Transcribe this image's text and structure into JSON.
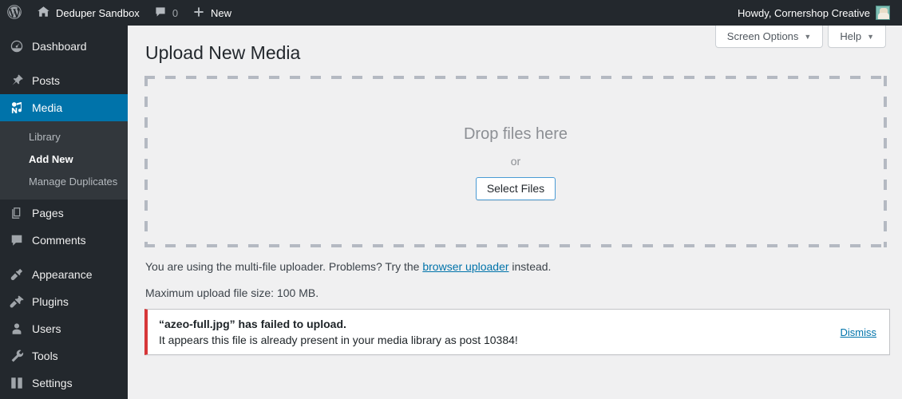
{
  "adminbar": {
    "logo_icon": "wordpress-logo-icon",
    "home_icon": "home-icon",
    "site_name": "Deduper Sandbox",
    "comments_icon": "comment-bubble-icon",
    "comments_count": "0",
    "new_icon": "plus-icon",
    "new_label": "New",
    "howdy": "Howdy, Cornershop Creative",
    "avatar": "user-avatar"
  },
  "sidebar": {
    "items": [
      {
        "label": "Dashboard",
        "icon": "dashboard-icon",
        "current": false,
        "gap_after": true
      },
      {
        "label": "Posts",
        "icon": "pin-icon",
        "current": false,
        "gap_after": false
      },
      {
        "label": "Media",
        "icon": "media-icon",
        "current": true,
        "gap_after": false
      }
    ],
    "submenu": [
      {
        "label": "Library",
        "current": false
      },
      {
        "label": "Add New",
        "current": true
      },
      {
        "label": "Manage Duplicates",
        "current": false
      }
    ],
    "items_lower": [
      {
        "label": "Pages",
        "icon": "pages-icon"
      },
      {
        "label": "Comments",
        "icon": "comment-icon"
      }
    ],
    "items_bottom": [
      {
        "label": "Appearance",
        "icon": "appearance-brush-icon"
      },
      {
        "label": "Plugins",
        "icon": "plugin-icon"
      },
      {
        "label": "Users",
        "icon": "user-icon"
      },
      {
        "label": "Tools",
        "icon": "wrench-icon"
      },
      {
        "label": "Settings",
        "icon": "settings-sliders-icon"
      }
    ]
  },
  "screen_meta": {
    "screen_options": "Screen Options",
    "help": "Help",
    "caret": "▼"
  },
  "page": {
    "title": "Upload New Media"
  },
  "dropzone": {
    "drop_text": "Drop files here",
    "or_text": "or",
    "select_files_label": "Select Files"
  },
  "info": {
    "uploader_prefix": "You are using the multi-file uploader. Problems? Try the ",
    "uploader_link": "browser uploader",
    "uploader_suffix": " instead.",
    "max_size": "Maximum upload file size: 100 MB."
  },
  "notice": {
    "title": "“azeo-full.jpg” has failed to upload.",
    "description": "It appears this file is already present in your media library as post 10384!",
    "dismiss_label": "Dismiss",
    "accent_color": "#d63638"
  },
  "colors": {
    "admin_blue": "#0073aa",
    "sidebar_dark": "#23282d",
    "submenu_dark": "#32373c",
    "content_bg": "#f0f0f1",
    "link": "#0073aa"
  }
}
